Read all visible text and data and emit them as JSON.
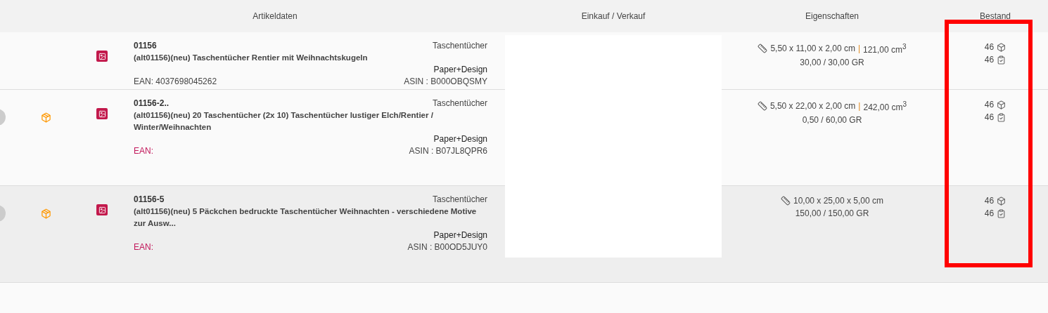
{
  "columns": [
    {
      "title": "Artikeldaten"
    },
    {
      "title": "Einkauf / Verkauf"
    },
    {
      "title": "Eigenschaften"
    },
    {
      "title": "Bestand"
    }
  ],
  "rows": [
    {
      "expand_handle": false,
      "variant_icon": false,
      "shaded": false,
      "sku": "01156",
      "name": "(alt01156)(neu) Taschentücher Rentier mit Weihnachtskugeln",
      "ean": "EAN: 4037698045262",
      "ean_missing": false,
      "category": "Taschentücher",
      "brand": "Paper+Design",
      "asin": "ASIN : B000OBQSMY",
      "dimensions": "5,50 x 11,00 x 2,00 cm",
      "separator": "|",
      "volume": "121,00 cm$^{3}$",
      "weight": "30,00 / 30,00 GR",
      "stock": "46",
      "available": "46"
    },
    {
      "expand_handle": true,
      "variant_icon": true,
      "shaded": false,
      "sku": "01156-2..",
      "name": "(alt01156)(neu) 20 Taschentücher (2x 10) Taschentücher lustiger Elch/Rentier / Winter/Weihnachten",
      "ean": "EAN:",
      "ean_missing": true,
      "category": "Taschentücher",
      "brand": "Paper+Design",
      "asin": "ASIN : B07JL8QPR6",
      "dimensions": "5,50 x 22,00 x 2,00 cm",
      "separator": "|",
      "volume": "242,00 cm$^{3}$",
      "weight": "0,50 / 60,00 GR",
      "stock": "46",
      "available": "46"
    },
    {
      "expand_handle": true,
      "variant_icon": true,
      "shaded": true,
      "sku": "01156-5",
      "name": "(alt01156)(neu) 5 Päckchen bedruckte Taschentücher Weihnachten - verschiedene Motive zur Ausw...",
      "ean": "EAN:",
      "ean_missing": true,
      "category": "Taschentücher",
      "brand": "Paper+Design",
      "asin": "ASIN : B00OD5JUY0",
      "dimensions": "10,00 x 25,00 x 5,00 cm",
      "weight": "150,00 / 150,00 GR",
      "stock": "46",
      "available": "46"
    }
  ]
}
